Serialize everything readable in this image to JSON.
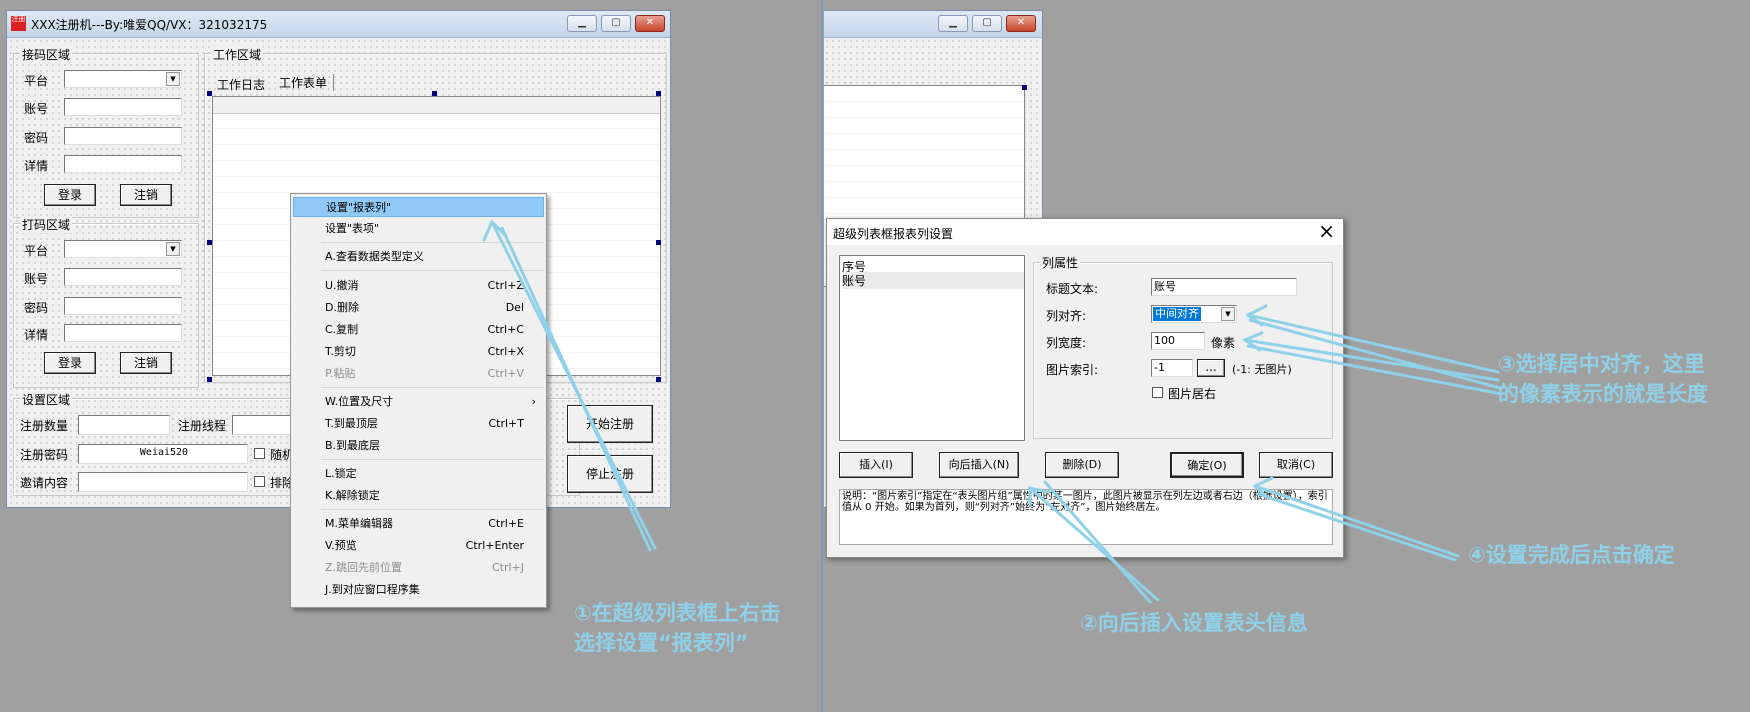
{
  "left_window": {
    "title": "XXX注册机---By:唯爱QQ/VX：321032175",
    "receive_group": {
      "title": "接码区域",
      "platform_label": "平台",
      "account_label": "账号",
      "password_label": "密码",
      "details_label": "详情",
      "login_label": "登录",
      "logout_label": "注销"
    },
    "code_group": {
      "title": "打码区域",
      "platform_label": "平台",
      "account_label": "账号",
      "password_label": "密码",
      "details_label": "详情",
      "login_label": "登录",
      "logout_label": "注销"
    },
    "work_group": {
      "title": "工作区域",
      "tabs": [
        "工作日志",
        "工作表单"
      ]
    },
    "settings_group": {
      "title": "设置区域",
      "reg_count_label": "注册数量",
      "reg_threads_label": "注册线程",
      "reg_password_label": "注册密码",
      "reg_password_value": "Weiai520",
      "random_label": "随机",
      "invite_label": "邀请内容",
      "exclude_label": "排除",
      "start_label": "开始注册",
      "stop_label": "停止注册"
    }
  },
  "context_menu": {
    "items": [
      {
        "text": "设置\"报表列\"",
        "shortcut": ""
      },
      {
        "text": "设置\"表项\"",
        "shortcut": ""
      },
      {
        "text": "A.查看数据类型定义",
        "shortcut": ""
      },
      {
        "text": "U.撤消",
        "shortcut": "Ctrl+Z"
      },
      {
        "text": "D.删除",
        "shortcut": "Del"
      },
      {
        "text": "C.复制",
        "shortcut": "Ctrl+C"
      },
      {
        "text": "T.剪切",
        "shortcut": "Ctrl+X"
      },
      {
        "text": "P.粘贴",
        "shortcut": "Ctrl+V"
      },
      {
        "text": "W.位置及尺寸",
        "shortcut": "›"
      },
      {
        "text": "T.到最顶层",
        "shortcut": "Ctrl+T"
      },
      {
        "text": "B.到最底层",
        "shortcut": ""
      },
      {
        "text": "L.锁定",
        "shortcut": ""
      },
      {
        "text": "K.解除锁定",
        "shortcut": ""
      },
      {
        "text": "M.菜单编辑器",
        "shortcut": "Ctrl+E"
      },
      {
        "text": "V.预览",
        "shortcut": "Ctrl+Enter"
      },
      {
        "text": "Z.跳回先前位置",
        "shortcut": "Ctrl+J"
      },
      {
        "text": "J.到对应窗口程序集",
        "shortcut": ""
      }
    ]
  },
  "dialog": {
    "title": "超级列表框报表列设置",
    "close": "×",
    "list_items": [
      "序号",
      "账号"
    ],
    "group_title": "列属性",
    "caption_label": "标题文本:",
    "caption_value": "账号",
    "align_label": "列对齐:",
    "align_value": "中间对齐",
    "width_label": "列宽度:",
    "width_value": "100",
    "width_unit": "像素",
    "image_index_label": "图片索引:",
    "image_index_value": "-1",
    "browse_label": "...",
    "image_index_hint": "(-1: 无图片)",
    "image_center_label": "图片居右",
    "btn_insert": "插入(I)",
    "btn_insert_after": "向后插入(N)",
    "btn_delete": "删除(D)",
    "btn_ok": "确定(O)",
    "btn_cancel": "取消(C)",
    "note": "    说明：“图片索引”指定在“表头图片组”属性中的某一图片，此图片被显示在列左边或者右边（根据设置），索引值从 0 开始。如果为首列，则“列对齐”始终为“左对齐”，图片始终居左。"
  },
  "annotations": {
    "a1_line1": "①在超级列表框上右击",
    "a1_line2": "选择设置“报表列”",
    "a2": "②向后插入设置表头信息",
    "a3_line1": "③选择居中对齐，这里",
    "a3_line2": "的像素表示的就是长度",
    "a4": "④设置完成后点击确定"
  },
  "colors": {
    "annotation": "#8fd1e8",
    "menu_highlight": "#91c9f7",
    "select_blue": "#0078d7",
    "desktop": "#a0a0a0"
  }
}
